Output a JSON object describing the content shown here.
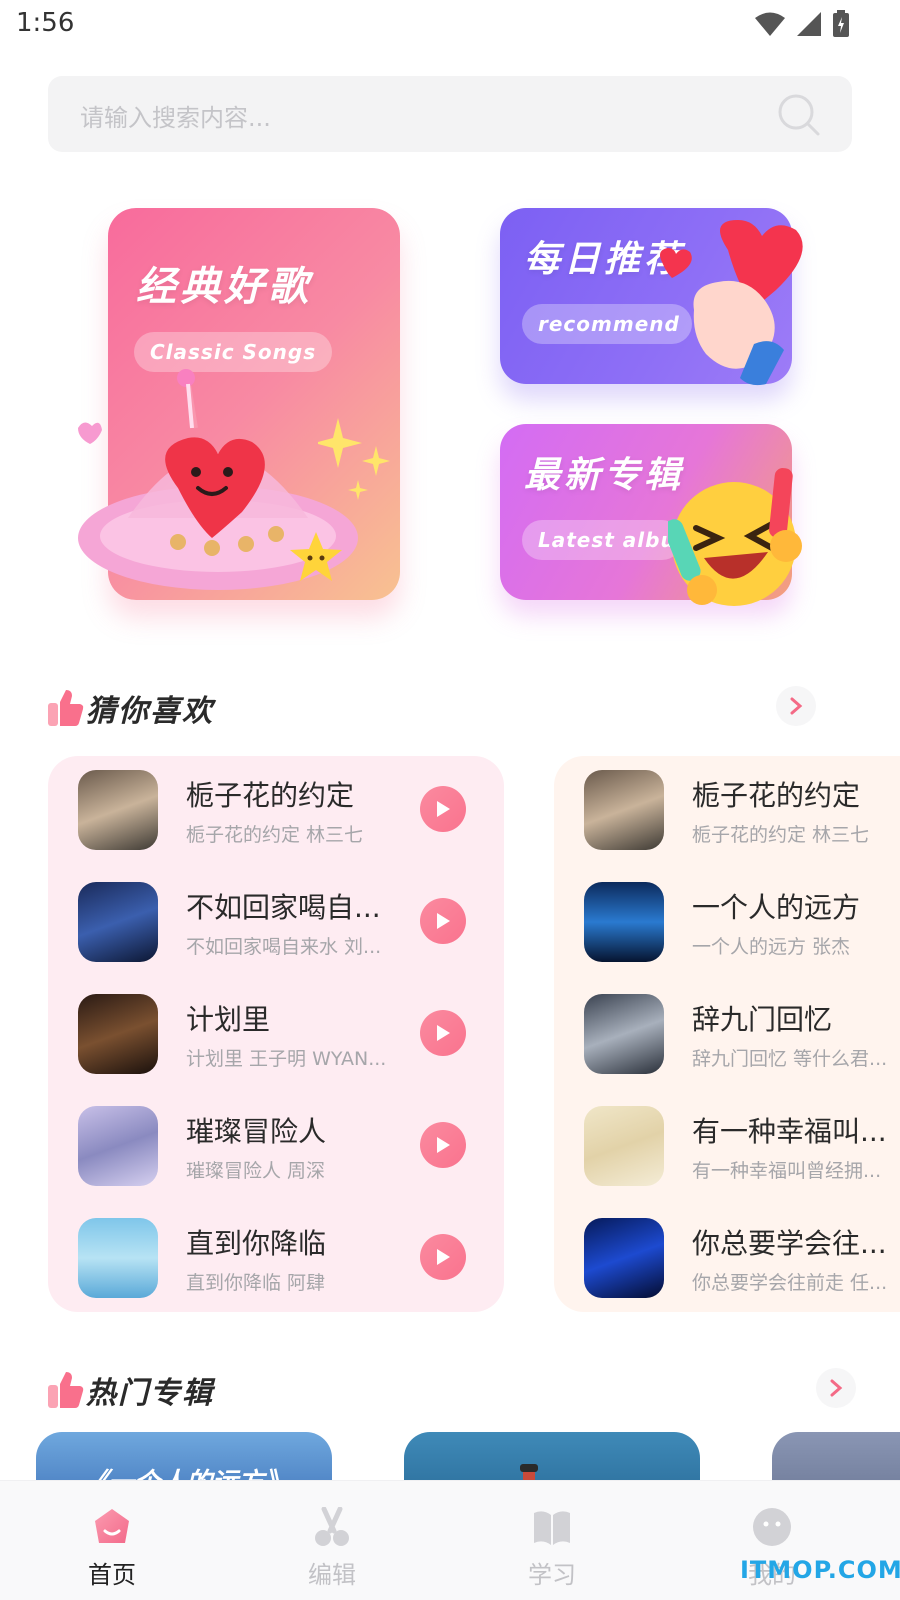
{
  "status_bar": {
    "time": "1:56"
  },
  "search": {
    "placeholder": "请输入搜索内容..."
  },
  "banners": {
    "classic": {
      "title": "经典好歌",
      "pill": "Classic Songs"
    },
    "daily": {
      "title": "每日推荐",
      "pill": "recommend"
    },
    "album": {
      "title": "最新专辑",
      "pill": "Latest album"
    }
  },
  "guess_section": {
    "title": "猜你喜欢"
  },
  "song_columns": [
    [
      {
        "title": "栀子花的约定",
        "subtitle": "栀子花的约定 林三七"
      },
      {
        "title": "不如回家喝自...",
        "subtitle": "不如回家喝自来水 刘..."
      },
      {
        "title": "计划里",
        "subtitle": "计划里 王子明 WYAN..."
      },
      {
        "title": "璀璨冒险人",
        "subtitle": "璀璨冒险人 周深"
      },
      {
        "title": "直到你降临",
        "subtitle": "直到你降临 阿肆"
      }
    ],
    [
      {
        "title": "栀子花的约定",
        "subtitle": "栀子花的约定 林三七"
      },
      {
        "title": "一个人的远方",
        "subtitle": "一个人的远方 张杰"
      },
      {
        "title": "辞九门回忆",
        "subtitle": "辞九门回忆 等什么君..."
      },
      {
        "title": "有一种幸福叫...",
        "subtitle": "有一种幸福叫曾经拥..."
      },
      {
        "title": "你总要学会往...",
        "subtitle": "你总要学会往前走 任..."
      }
    ]
  ],
  "hot_section": {
    "title": "热门专辑",
    "album_tile_text": "《一个人的远方》"
  },
  "bottom_nav": [
    {
      "label": "首页",
      "icon": "home-icon",
      "active": true
    },
    {
      "label": "编辑",
      "icon": "scissors-icon",
      "active": false
    },
    {
      "label": "学习",
      "icon": "book-icon",
      "active": false
    },
    {
      "label": "我的",
      "icon": "smile-icon",
      "active": false
    }
  ],
  "watermark": "ITMOP.COM",
  "colors": {
    "accent": "#f9738e",
    "purple": "#7c60f3",
    "magenta": "#d36cf4"
  }
}
